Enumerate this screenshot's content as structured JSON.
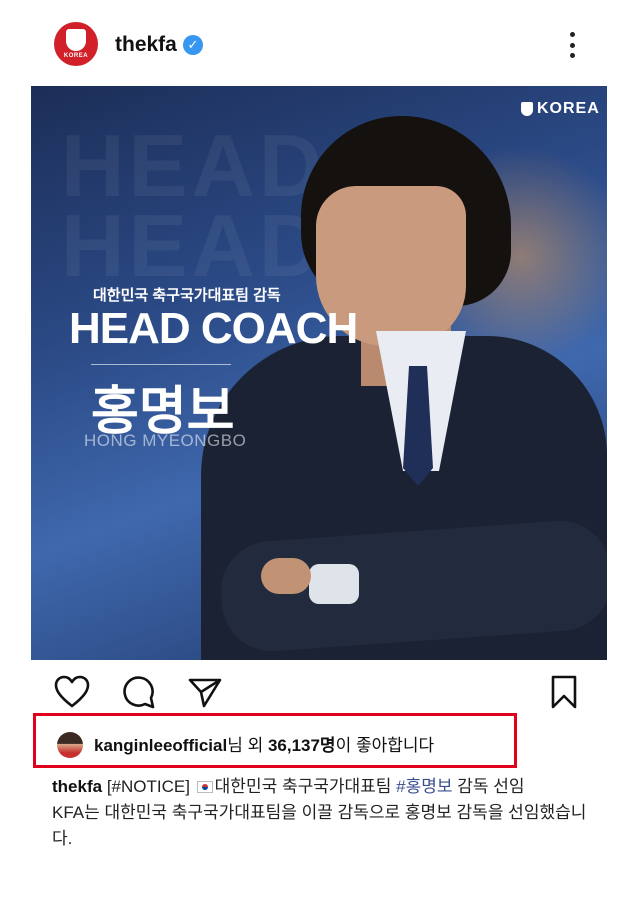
{
  "header": {
    "username": "thekfa",
    "avatar_text": "KOREA",
    "verified_icon": "verified-badge-icon",
    "more_icon": "more-options-icon"
  },
  "post_image": {
    "brand": "KOREA",
    "background_text": "HEAD HEAD",
    "subtitle": "대한민국 축구국가대표팀 감독",
    "headline": "HEAD COACH",
    "name_korean": "홍명보",
    "name_english": "HONG MYEONGBO"
  },
  "actions": {
    "like_icon": "heart-icon",
    "comment_icon": "comment-icon",
    "share_icon": "share-icon",
    "save_icon": "bookmark-icon"
  },
  "likes": {
    "user": "kanginleeofficial",
    "middle": "님 외 ",
    "count": "36,137명",
    "suffix": "이 좋아합니다"
  },
  "caption": {
    "user": "thekfa",
    "notice": "[#NOTICE]",
    "flag_icon": "south-korea-flag-icon",
    "text1": "대한민국 축구국가대표팀",
    "hashtag": "#홍명보",
    "text2": "감독 선임",
    "body": "KFA는 대한민국 축구국가대표팀을 이끌 감독으로 홍명보 감독을 선임했습니다."
  },
  "colors": {
    "highlight_border": "#e0001b",
    "verified": "#3797f0",
    "brand_red": "#d2202a",
    "hashtag": "#3a4f8f"
  }
}
